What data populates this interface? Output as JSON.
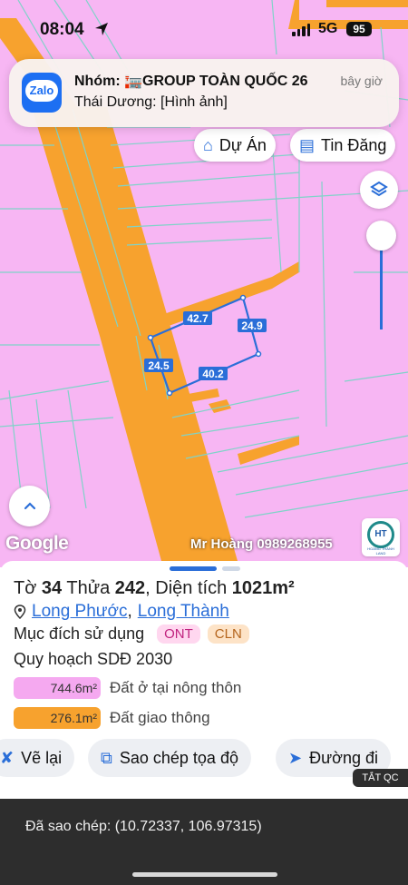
{
  "status_bar": {
    "time": "08:04",
    "network": "5G",
    "battery": "95"
  },
  "notification": {
    "app": "Zalo",
    "title": "Nhóm: 🏣GROUP TOÀN QUỐC 26",
    "time": "bây giờ",
    "body": "Thái Dương: [Hình ảnh]"
  },
  "map": {
    "buttons": {
      "du_an": "Dự Án",
      "tin_dang": "Tin Đăng"
    },
    "parcel_dims": {
      "top": "42.7",
      "right": "24.9",
      "left": "24.5",
      "bottom": "40.2"
    },
    "google_logo": "Google",
    "watermark": "Mr Hoàng 0989268955",
    "logo_caption": "HOÀNG THÀNH LAND",
    "colors": {
      "land": "#f7b6f3",
      "road": "#f7a22e",
      "parcel_border": "#2a6ed8"
    }
  },
  "sheet": {
    "title_prefix": "Tờ",
    "sheet_no": "34",
    "plot_label": "Thửa",
    "plot_no": "242",
    "area_label": "Diện tích",
    "area_value": "1021m²",
    "location_1": "Long Phước",
    "location_sep": ",",
    "location_2": "Long Thành",
    "purpose_label": "Mục đích sử dụng",
    "tags": [
      "ONT",
      "CLN"
    ],
    "plan_title": "Quy hoạch SDĐ 2030",
    "legend": [
      {
        "area": "744.6m²",
        "label": "Đất ở tại nông thôn",
        "color": "#f5a9f0"
      },
      {
        "area": "276.1m²",
        "label": "Đất giao thông",
        "color": "#f7a22e"
      }
    ],
    "actions": {
      "redraw": "Vẽ lại",
      "copy": "Sao chép tọa độ",
      "route": "Đường đi"
    }
  },
  "ad_tag": "TẮT QC",
  "toast": {
    "text": "Đã sao chép: (10.72337, 106.97315)"
  }
}
